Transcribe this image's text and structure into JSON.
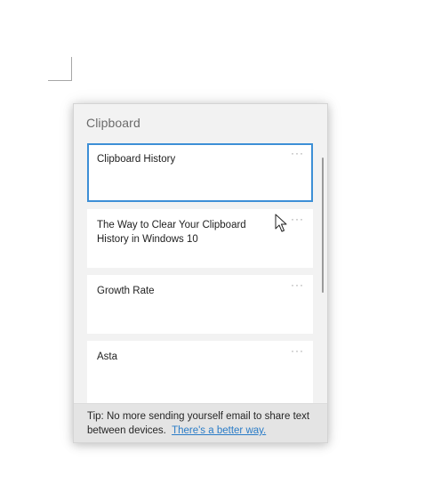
{
  "clipboard": {
    "title": "Clipboard",
    "items": [
      {
        "text": "Clipboard History",
        "more": "···"
      },
      {
        "text": "The Way to Clear Your Clipboard History in Windows 10",
        "more": "···"
      },
      {
        "text": "Growth Rate",
        "more": "···"
      },
      {
        "text": "Asta",
        "more": "···"
      }
    ],
    "tip": {
      "text": "Tip: No more sending yourself email to share text between devices.",
      "link": "There's a better way."
    }
  },
  "icons": {
    "cursor": "mouse-pointer-icon",
    "more": "more-options-icon"
  },
  "colors": {
    "selection_border": "#3d8fd6",
    "link": "#2a7cc7",
    "panel_background": "#f2f2f2",
    "tip_background": "#e4e4e4"
  }
}
